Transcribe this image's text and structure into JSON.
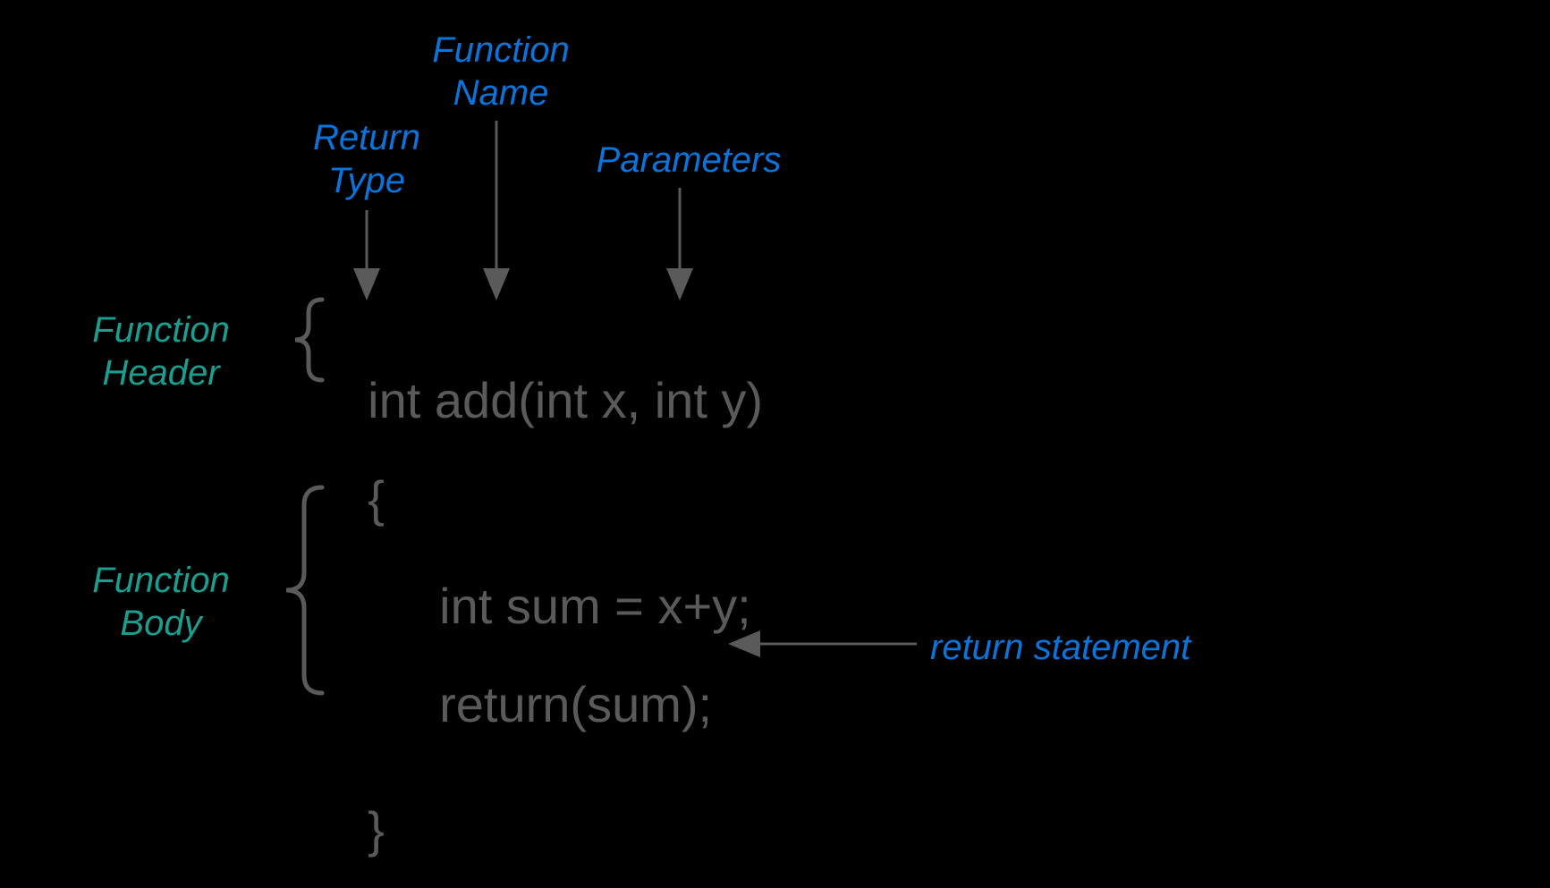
{
  "labels": {
    "function_name_line1": "Function",
    "function_name_line2": "Name",
    "return_type_line1": "Return",
    "return_type_line2": "Type",
    "parameters": "Parameters",
    "function_header_line1": "Function",
    "function_header_line2": "Header",
    "function_body_line1": "Function",
    "function_body_line2": "Body",
    "return_statement": "return statement"
  },
  "code": {
    "line1": "int add(int x, int y)",
    "line2": "{",
    "line3": "int sum = x+y;",
    "line4": "return(sum);",
    "line5": "}"
  }
}
